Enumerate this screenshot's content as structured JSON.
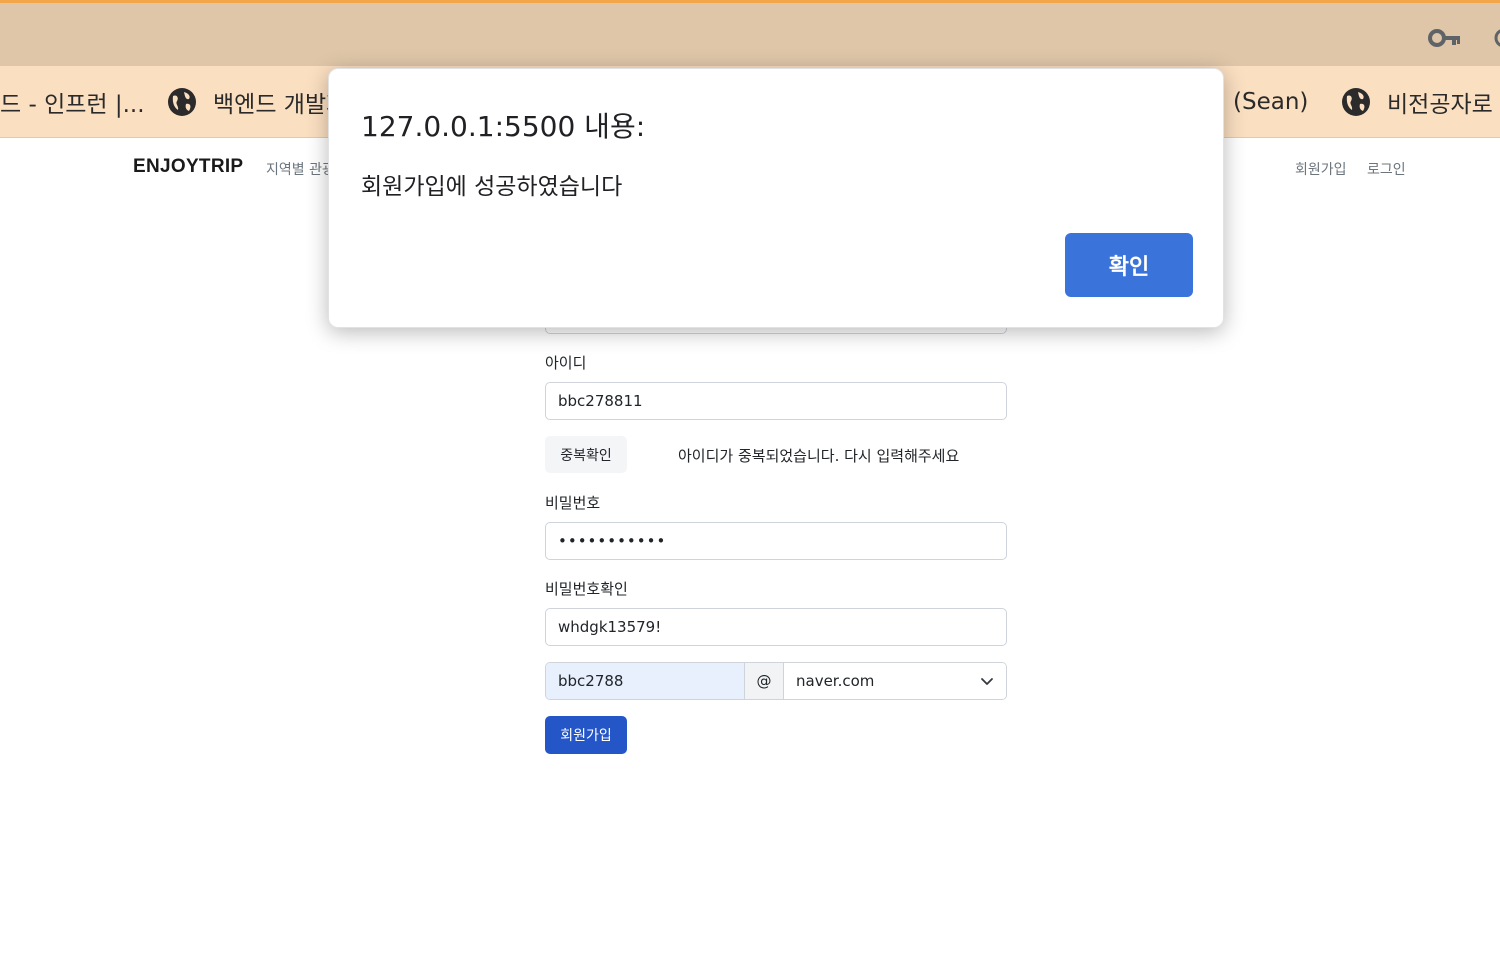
{
  "colors": {
    "toolbar_bg": "#dfc6a8",
    "bookmarks_bg": "#fbdfc1",
    "accent": "#f4a64a",
    "primary_button": "#2456c8",
    "dialog_button": "#3a74db"
  },
  "browser": {
    "toolbar_icons": [
      "key-icon",
      "partial-icon"
    ],
    "bookmarks": [
      {
        "label": "드 - 인프런 |...",
        "icon": null
      },
      {
        "label": "백엔드 개발자",
        "icon": "globe-icon"
      },
      {
        "label": "(Sean)",
        "icon": null
      },
      {
        "label": "비전공자로",
        "icon": "globe-icon"
      }
    ]
  },
  "navbar": {
    "brand": "ENJOYTRIP",
    "left_link": "지역별 관광지",
    "signup_link": "회원가입",
    "login_link": "로그인"
  },
  "form": {
    "id_label": "아이디",
    "id_value": "bbc278811",
    "dup_check_button": "중복확인",
    "dup_message": "아이디가 중복되었습니다. 다시 입력해주세요",
    "password_label": "비밀번호",
    "password_masked": "•••••••••••",
    "password_confirm_label": "비밀번호확인",
    "password_confirm_value": "whdgk13579!",
    "email_id": "bbc2788",
    "email_at": "@",
    "email_domain": "naver.com",
    "submit_button": "회원가입"
  },
  "dialog": {
    "title": "127.0.0.1:5500 내용:",
    "message": "회원가입에 성공하였습니다",
    "ok_button": "확인"
  }
}
